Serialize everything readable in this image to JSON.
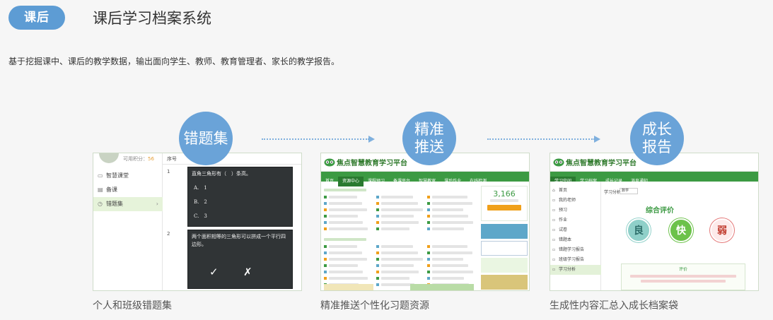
{
  "header": {
    "tag": "课后",
    "title": "课后学习档案系统"
  },
  "description": "基于挖掘课中、课后的教学数据，输出面向学生、教师、教育管理者、家长的教学报告。",
  "steps": [
    {
      "circle": [
        "错题集"
      ],
      "caption": "个人和班级错题集"
    },
    {
      "circle": [
        "精准",
        "推送"
      ],
      "caption": "精准推送个性化习题资源"
    },
    {
      "circle": [
        "成长",
        "报告"
      ],
      "caption": "生成性内容汇总入成长档案袋"
    }
  ],
  "wrongbook": {
    "points_label": "可用积分：",
    "points_value": "56",
    "menu": [
      "智慧课堂",
      "备课",
      "错题集"
    ],
    "column_header": "序号",
    "items": [
      {
        "num": "1",
        "question": "直角三角形有（　）条高。",
        "options": [
          "A.　1",
          "B.　2",
          "C.　3"
        ]
      },
      {
        "num": "2",
        "question": "两个面积相等的三角形可以拼成一个平行四边形。",
        "marks": [
          "✓",
          "✗"
        ]
      }
    ]
  },
  "platform": {
    "name": "焦点智慧教育学习平台"
  },
  "push": {
    "nav": [
      "首页",
      "资源中心",
      "课程预习",
      "备课平台",
      "智慧教室",
      "课后作业",
      "在线检测"
    ],
    "stat_value": "3,166",
    "colors": {
      "green": "#3c9a43",
      "orange": "#f0a01a"
    }
  },
  "report": {
    "nav": [
      "学习空间",
      "学习档案",
      "成长记录",
      "消息通知"
    ],
    "menu": [
      "首页",
      "我的老师",
      "预习",
      "作业",
      "试卷",
      "错题本",
      "错题学习报告",
      "班级学习报告",
      "学习分析"
    ],
    "subject_label": "学习分析",
    "subject_value": "数学",
    "eval_title": "综合评价",
    "grades": [
      {
        "label": "良",
        "color": "#8fd0c9"
      },
      {
        "label": "快",
        "color": "#6cc24a"
      },
      {
        "label": "弱",
        "color": "#f3c3c3"
      }
    ],
    "summary_title": "评价"
  }
}
